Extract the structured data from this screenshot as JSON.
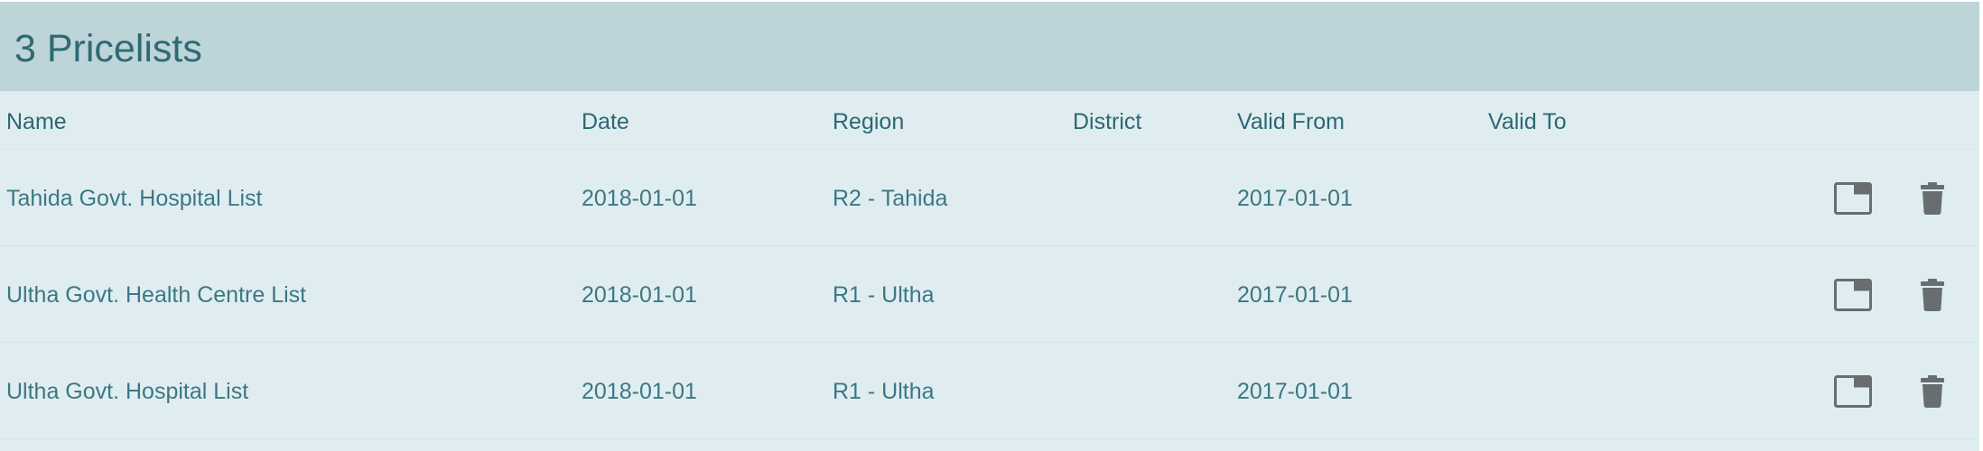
{
  "panel": {
    "title": "3 Pricelists"
  },
  "table": {
    "columns": {
      "name": "Name",
      "date": "Date",
      "region": "Region",
      "district": "District",
      "valid_from": "Valid From",
      "valid_to": "Valid To"
    },
    "rows": [
      {
        "name": "Tahida Govt. Hospital List",
        "date": "2018-01-01",
        "region": "R2 - Tahida",
        "district": "",
        "valid_from": "2017-01-01",
        "valid_to": ""
      },
      {
        "name": "Ultha Govt. Health Centre List",
        "date": "2018-01-01",
        "region": "R1 - Ultha",
        "district": "",
        "valid_from": "2017-01-01",
        "valid_to": ""
      },
      {
        "name": "Ultha Govt. Hospital List",
        "date": "2018-01-01",
        "region": "R1 - Ultha",
        "district": "",
        "valid_from": "2017-01-01",
        "valid_to": ""
      }
    ]
  },
  "icons": {
    "open": "open-in-new-window-icon",
    "delete": "trash-icon"
  },
  "colors": {
    "header_bg": "#bdd5d9",
    "panel_bg": "#e0edf0",
    "text": "#2f6d79",
    "icon": "#686d70"
  }
}
